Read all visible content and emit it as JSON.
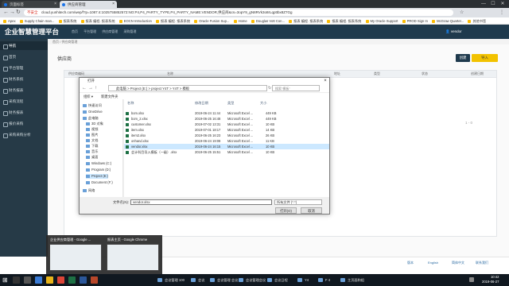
{
  "browser": {
    "tabs": [
      {
        "label": "页面标签"
      },
      {
        "label": "供应商管理"
      }
    ],
    "window_controls": {
      "minimize": "—",
      "maximize": "☐",
      "close": "✕"
    },
    "security_label": "不安全",
    "url": "cloud.yunhitech.com/wep/f?p=1087:4:1025755852572:NO:P4,P4_PARTY_TYPE,P4_PARTY_NAME:VENDOR,供应商&cs=3opY9_gN8RVk3o8rLqpttbx8Z7Gg",
    "bookmarks": [
      "Apex",
      "Supply Chain man...",
      "报表系统",
      "报表 编程. 报表系统",
      "EOCN Introduction",
      "报表 编程. 报表系统",
      "Oracle Fusion Sup...",
      "Home",
      "Douglas Vott Con...",
      "报表 编程. 报表系统",
      "报表 编程. 报表系统",
      "My Oracle Support",
      "PROD Sign In",
      "McGraw Quarter...",
      "其他书签"
    ]
  },
  "app": {
    "title": "企业智慧管理平台",
    "top_nav": [
      "首页",
      "平台管理",
      "供应商管理",
      "采购管理"
    ],
    "user": "vendor"
  },
  "sidebar": {
    "items": [
      {
        "label": "导航"
      },
      {
        "label": "首页"
      },
      {
        "label": "平台管理"
      },
      {
        "label": "财务系统"
      },
      {
        "label": "财务报表"
      },
      {
        "label": "采购流程"
      },
      {
        "label": "财务报表"
      },
      {
        "label": "报价采购"
      },
      {
        "label": "采购采购分析"
      }
    ]
  },
  "main": {
    "breadcrumb": "首页 / 供应商管理",
    "page_title": "供应商",
    "buttons": {
      "primary": "创建",
      "secondary": "导入"
    },
    "grid_headers": [
      "供应商编码",
      "名称",
      "地址",
      "类型",
      "状态",
      "创建日期"
    ],
    "pager": "1 - 0"
  },
  "footer": {
    "links": [
      "版本",
      "English",
      "简体中文",
      "联系我们"
    ]
  },
  "file_dialog": {
    "title": "打开",
    "path": "此电脑 > Project (E:) > project Y4T > Y4T > 模板",
    "search_placeholder": "搜索\"模板\"",
    "toolbar": {
      "organize": "组织 ▾",
      "new_folder": "新建文件夹"
    },
    "tree": [
      {
        "label": "快速访问"
      },
      {
        "label": "OneDrive"
      },
      {
        "label": "此电脑"
      },
      {
        "label": "3D 对象"
      },
      {
        "label": "视频"
      },
      {
        "label": "图片"
      },
      {
        "label": "文档"
      },
      {
        "label": "下载"
      },
      {
        "label": "音乐"
      },
      {
        "label": "桌面"
      },
      {
        "label": "Windows (C:)"
      },
      {
        "label": "Program (D:)"
      },
      {
        "label": "Project (E:)"
      },
      {
        "label": "Document (F:)"
      },
      {
        "label": "网络"
      }
    ],
    "columns": {
      "name": "名称",
      "date": "修改日期",
      "type": "类型",
      "size": "大小"
    },
    "files": [
      {
        "name": "bom.xlsx",
        "date": "2019-06-24 11:44",
        "type": "Microsoft Excel ...",
        "size": "449 KB"
      },
      {
        "name": "bom_2.xlsx",
        "date": "2019-06-25 16:48",
        "type": "Microsoft Excel ...",
        "size": "449 KB"
      },
      {
        "name": "customer.xlsx",
        "date": "2019-07-02 13:31",
        "type": "Microsoft Excel ...",
        "size": "10 KB"
      },
      {
        "name": "item.xlsx",
        "date": "2019-07-01 18:17",
        "type": "Microsoft Excel ...",
        "size": "14 KB"
      },
      {
        "name": "item2.xlsx",
        "date": "2019-06-25 16:23",
        "type": "Microsoft Excel ...",
        "size": "26 KB"
      },
      {
        "name": "onhand.xlsx",
        "date": "2019-06-24 19:08",
        "type": "Microsoft Excel ...",
        "size": "11 KB"
      },
      {
        "name": "vendor.xlsx",
        "date": "2019-06-24 16:15",
        "type": "Microsoft Excel ...",
        "size": "10 KB"
      },
      {
        "name": "会计科目导入模板（一级）.xlsx",
        "date": "2019-06-25 15:51",
        "type": "Microsoft Excel ...",
        "size": "10 KB"
      }
    ],
    "filename_label": "文件名(N):",
    "filename_value": "vendor.xlsx",
    "file_type": "所有文件 (*.*)",
    "open_button": "打开(O)",
    "cancel_button": "取消"
  },
  "taskbar": {
    "thumbnails": [
      {
        "title": "企业供应商管理 - Google ..."
      },
      {
        "title": "报表主页 - Google Chrome"
      }
    ],
    "items": [
      "会议管理 100",
      "会议",
      "会议管理 会议",
      "会议管理会议",
      "会议日程",
      "Y4",
      "F 4",
      "主页面和组"
    ],
    "time": "10:42",
    "date": "2019-06-27"
  }
}
